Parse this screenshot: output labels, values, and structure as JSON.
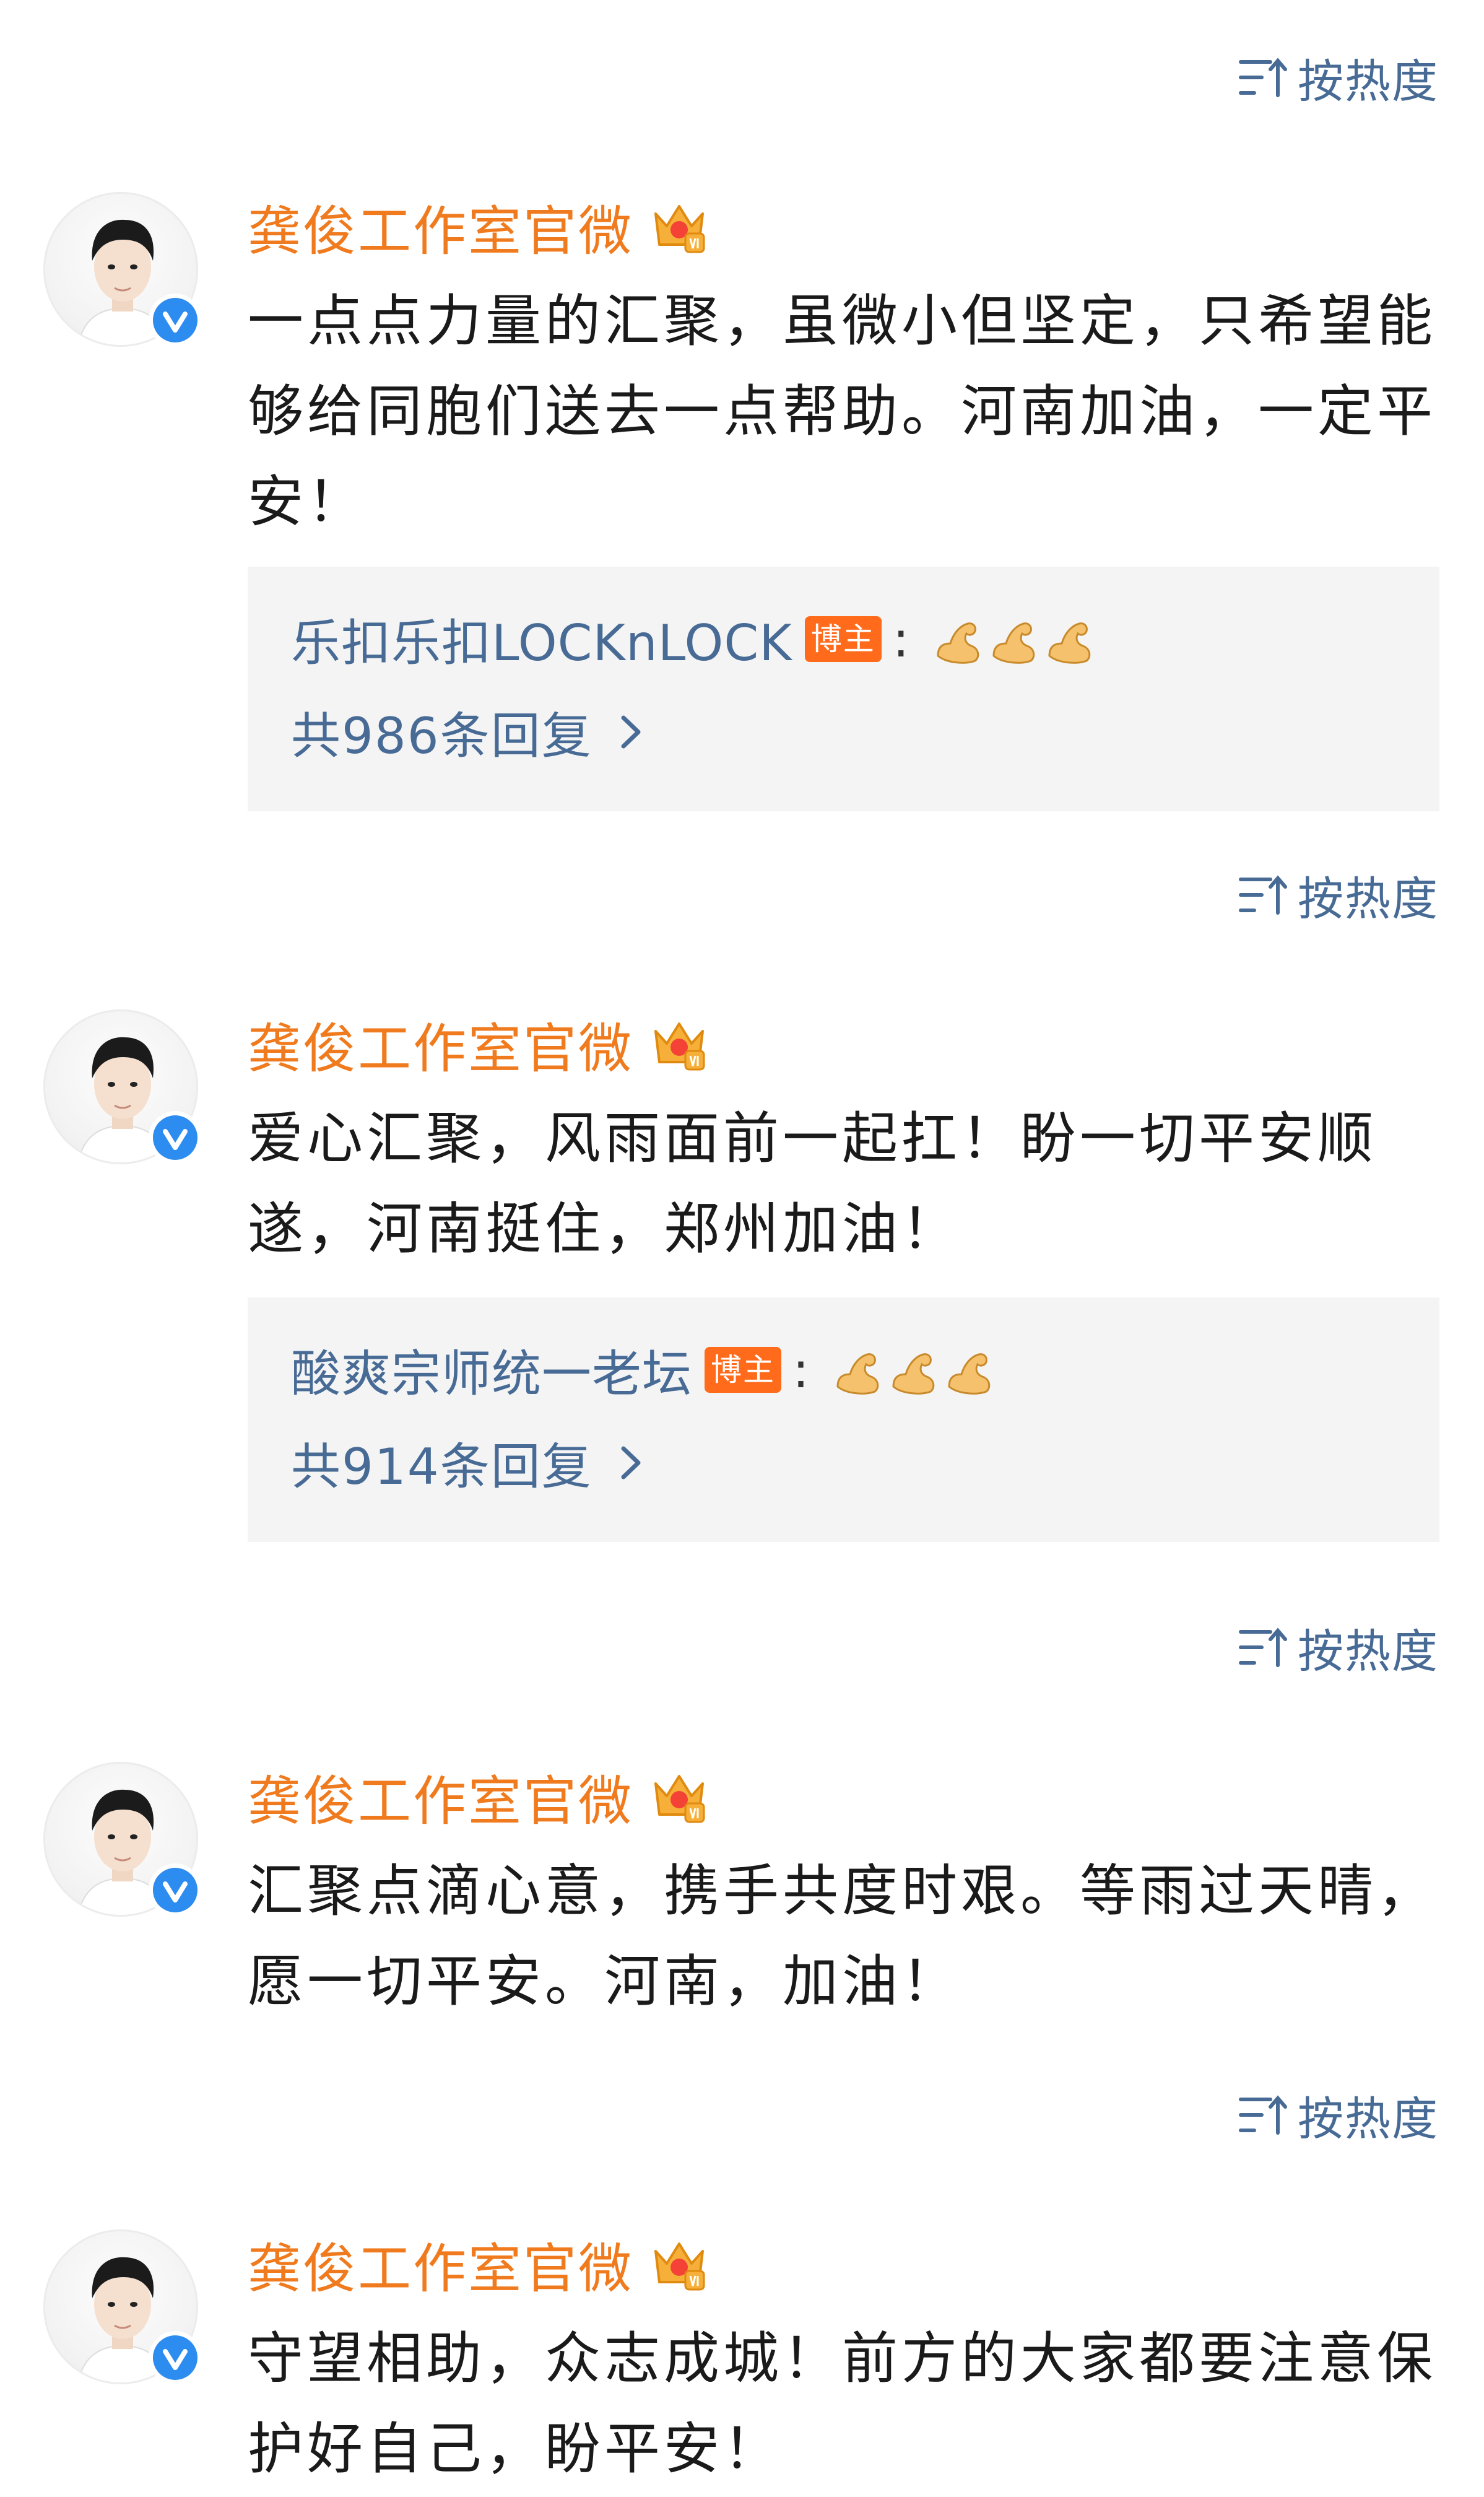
{
  "sort_label": "按热度",
  "author": "龚俊工作室官微",
  "badge_label": "博主",
  "colors": {
    "author": "#f07b1f",
    "link": "#486b96",
    "text": "#1a1a1a",
    "badge": "#ff6b1a",
    "verified": "#2d8cf0"
  },
  "icons": {
    "sort": "sort-by-heat-icon",
    "vip": "vip-crown-icon",
    "verified": "verified-v-icon",
    "emoji": "flexed-biceps-emoji",
    "chevron": "chevron-right-icon"
  },
  "posts": [
    {
      "text": "一点点力量的汇聚，虽微小但坚定，只希望能够给同胞们送去一点帮助。河南加油，一定平安！",
      "reply": {
        "user": "乐扣乐扣LOCKnLOCK",
        "count_text": "共986条回复"
      }
    },
    {
      "text": "爱心汇聚，风雨面前一起扛！盼一切平安顺遂，河南挺住，郑州加油！",
      "reply": {
        "user": "酸爽宗师统一老坛",
        "count_text": "共914条回复"
      }
    },
    {
      "text": "汇聚点滴心意，携手共度时艰。等雨过天晴，愿一切平安。河南，加油！"
    },
    {
      "text": "守望相助，众志成城！前方的大家都要注意保护好自己，盼平安！"
    }
  ]
}
